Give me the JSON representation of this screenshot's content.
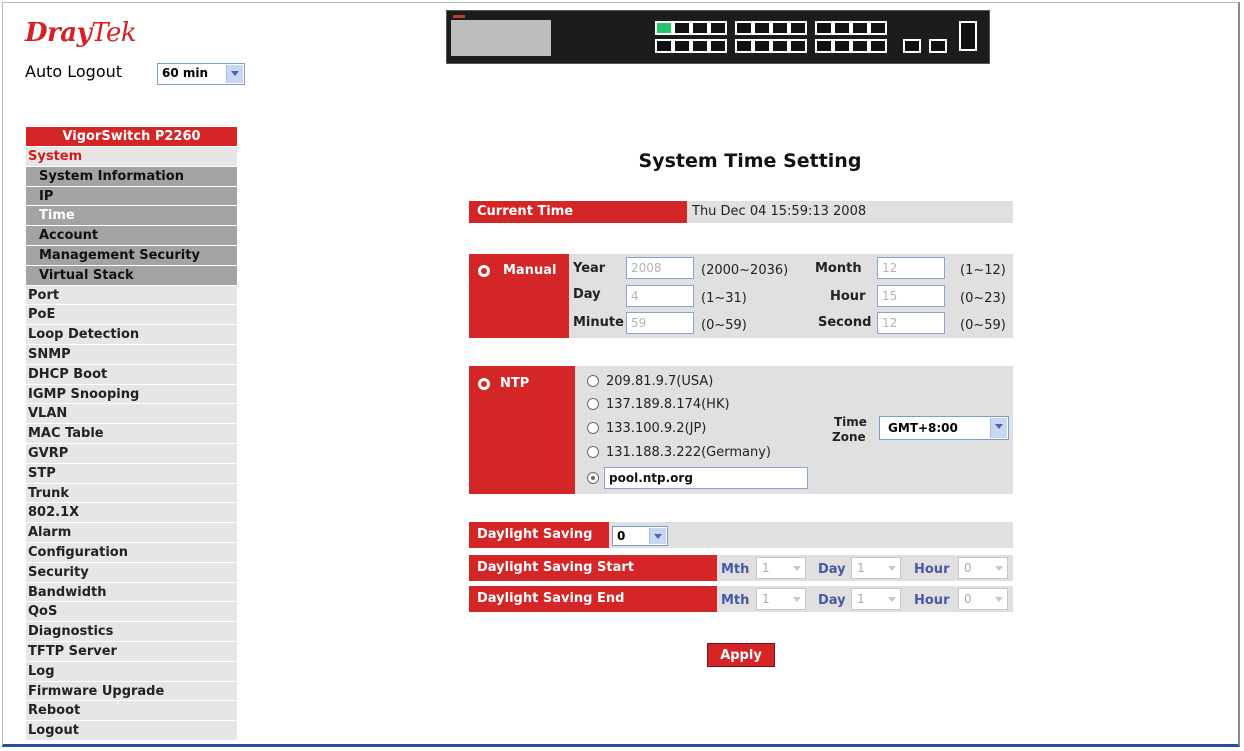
{
  "brand": {
    "name_part1": "Dray",
    "name_part2": "Tek",
    "accent": "#d42626"
  },
  "auto_logout": {
    "label": "Auto Logout",
    "value": "60 min"
  },
  "sidebar": {
    "device": "VigorSwitch P2260",
    "items": [
      {
        "label": "System"
      },
      {
        "label": "System Information"
      },
      {
        "label": "IP"
      },
      {
        "label": "Time"
      },
      {
        "label": "Account"
      },
      {
        "label": "Management Security"
      },
      {
        "label": "Virtual Stack"
      },
      {
        "label": "Port"
      },
      {
        "label": "PoE"
      },
      {
        "label": "Loop Detection"
      },
      {
        "label": "SNMP"
      },
      {
        "label": "DHCP Boot"
      },
      {
        "label": "IGMP Snooping"
      },
      {
        "label": "VLAN"
      },
      {
        "label": "MAC Table"
      },
      {
        "label": "GVRP"
      },
      {
        "label": "STP"
      },
      {
        "label": "Trunk"
      },
      {
        "label": "802.1X"
      },
      {
        "label": "Alarm"
      },
      {
        "label": "Configuration"
      },
      {
        "label": "Security"
      },
      {
        "label": "Bandwidth"
      },
      {
        "label": "QoS"
      },
      {
        "label": "Diagnostics"
      },
      {
        "label": "TFTP Server"
      },
      {
        "label": "Log"
      },
      {
        "label": "Firmware Upgrade"
      },
      {
        "label": "Reboot"
      },
      {
        "label": "Logout"
      }
    ]
  },
  "main": {
    "title": "System Time Setting",
    "current_time": {
      "label": "Current Time",
      "value": "Thu Dec 04 15:59:13 2008"
    },
    "manual": {
      "label": "Manual",
      "year": {
        "label": "Year",
        "value": "2008",
        "range": "(2000~2036)"
      },
      "month": {
        "label": "Month",
        "value": "12",
        "range": "(1~12)"
      },
      "day": {
        "label": "Day",
        "value": "4",
        "range": "(1~31)"
      },
      "hour": {
        "label": "Hour",
        "value": "15",
        "range": "(0~23)"
      },
      "minute": {
        "label": "Minute",
        "value": "59",
        "range": "(0~59)"
      },
      "second": {
        "label": "Second",
        "value": "12",
        "range": "(0~59)"
      }
    },
    "ntp": {
      "label": "NTP",
      "servers": [
        "209.81.9.7(USA)",
        "137.189.8.174(HK)",
        "133.100.9.2(JP)",
        "131.188.3.222(Germany)"
      ],
      "custom_value": "pool.ntp.org",
      "time_zone_label_1": "Time",
      "time_zone_label_2": "Zone",
      "time_zone_value": "GMT+8:00"
    },
    "daylight": {
      "label": "Daylight Saving",
      "value": "0",
      "start_label": "Daylight Saving Start",
      "end_label": "Daylight Saving End",
      "mth_label": "Mth",
      "day_label": "Day",
      "hour_label": "Hour",
      "start": {
        "mth": "1",
        "day": "1",
        "hour": "0"
      },
      "end": {
        "mth": "1",
        "day": "1",
        "hour": "0"
      }
    },
    "apply_label": "Apply"
  }
}
